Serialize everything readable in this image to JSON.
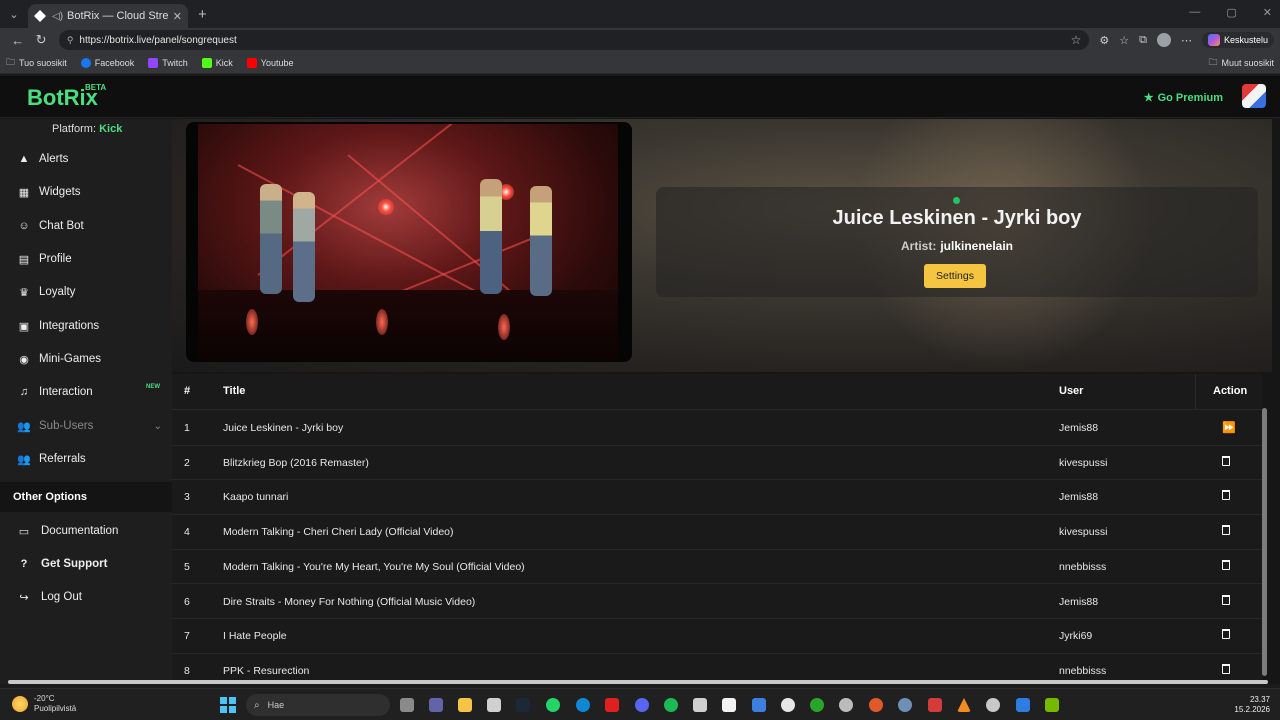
{
  "browser": {
    "tab_title": "BotRix — Cloud Streaming Bot",
    "url": "https://botrix.live/panel/songrequest",
    "copilot_label": "Keskustelu",
    "bookmarks": [
      "Tuo suosikit",
      "Facebook",
      "Twitch",
      "Kick",
      "Youtube"
    ],
    "other_bookmarks": "Muut suosikit"
  },
  "header": {
    "brand": "BotRix",
    "beta": "BETA",
    "premium": "Go Premium"
  },
  "sidebar": {
    "platform_label": "Platform:",
    "platform_value": "Kick",
    "items": [
      {
        "label": "Alerts",
        "icon": "warning-icon"
      },
      {
        "label": "Widgets",
        "icon": "grid-icon"
      },
      {
        "label": "Chat Bot",
        "icon": "robot-icon"
      },
      {
        "label": "Profile",
        "icon": "id-card-icon"
      },
      {
        "label": "Loyalty",
        "icon": "trophy-icon"
      },
      {
        "label": "Integrations",
        "icon": "plug-icon"
      },
      {
        "label": "Mini-Games",
        "icon": "gamepad-icon"
      },
      {
        "label": "Interaction",
        "icon": "music-icon",
        "badge": "NEW"
      },
      {
        "label": "Sub-Users",
        "icon": "users-icon"
      },
      {
        "label": "Referrals",
        "icon": "referral-icon"
      }
    ],
    "other_options": "Other Options",
    "options": [
      {
        "label": "Documentation",
        "icon": "book-icon"
      },
      {
        "label": "Get Support",
        "icon": "question-icon"
      },
      {
        "label": "Log Out",
        "icon": "logout-icon"
      }
    ]
  },
  "now_playing": {
    "title": "Juice Leskinen - Jyrki boy",
    "artist_label": "Artist:",
    "artist": "julkinenelain",
    "settings": "Settings"
  },
  "queue": {
    "columns": [
      "#",
      "Title",
      "User",
      "Action"
    ],
    "rows": [
      {
        "n": "1",
        "title": "Juice Leskinen - Jyrki boy",
        "user": "Jemis88",
        "action": "skip"
      },
      {
        "n": "2",
        "title": "Blitzkrieg Bop (2016 Remaster)",
        "user": "kivespussi",
        "action": "delete"
      },
      {
        "n": "3",
        "title": "Kaapo tunnari",
        "user": "Jemis88",
        "action": "delete"
      },
      {
        "n": "4",
        "title": "Modern Talking - Cheri Cheri Lady (Official Video)",
        "user": "kivespussi",
        "action": "delete"
      },
      {
        "n": "5",
        "title": "Modern Talking - You're My Heart, You're My Soul (Official Video)",
        "user": "nnebbisss",
        "action": "delete"
      },
      {
        "n": "6",
        "title": "Dire Straits - Money For Nothing (Official Music Video)",
        "user": "Jemis88",
        "action": "delete"
      },
      {
        "n": "7",
        "title": "I Hate People",
        "user": "Jyrki69",
        "action": "delete"
      },
      {
        "n": "8",
        "title": "PPK - Resurection",
        "user": "nnebbisss",
        "action": "delete"
      }
    ]
  },
  "taskbar": {
    "temp": "-20°C",
    "weather": "Puolipilvistä",
    "search": "Hae",
    "time": "23.37",
    "date": "15.2.2026"
  },
  "colors": {
    "accent_green": "#4ade80",
    "settings_yellow": "#f5c542"
  }
}
